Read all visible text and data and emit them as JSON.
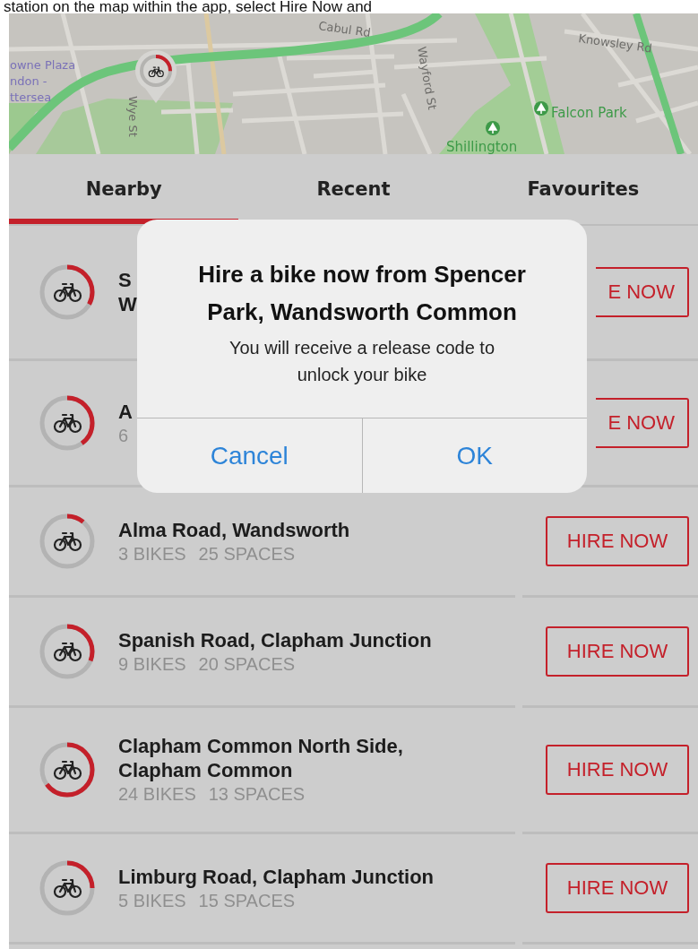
{
  "caption": "station on the map within the app, select Hire Now and",
  "map": {
    "pin": {
      "level": 0.25
    },
    "labels": [
      {
        "text": "Cabul Rd",
        "kind": "road"
      },
      {
        "text": "Knowsley Rd",
        "kind": "road"
      },
      {
        "text": "owne Plaza",
        "kind": "place"
      },
      {
        "text": "ndon -",
        "kind": "place"
      },
      {
        "text": "ttersea",
        "kind": "place"
      },
      {
        "text": "Wye St",
        "kind": "road"
      },
      {
        "text": "Wayford St",
        "kind": "road"
      },
      {
        "text": "Falcon Park",
        "kind": "park"
      },
      {
        "text": "Shillington",
        "kind": "park"
      }
    ]
  },
  "tabs": [
    {
      "label": "Nearby",
      "selected": true
    },
    {
      "label": "Recent",
      "selected": false
    },
    {
      "label": "Favourites",
      "selected": false
    }
  ],
  "stations": [
    {
      "name": [
        "S",
        "W"
      ],
      "level": 0.33,
      "button": "E NOW",
      "covered": true
    },
    {
      "name": [
        "A"
      ],
      "bikes": "6",
      "level": 0.4,
      "button": "E NOW",
      "covered": true
    },
    {
      "name": [
        "Alma Road, Wandsworth"
      ],
      "bikes": "3 BIKES",
      "spaces": "25 SPACES",
      "level": 0.11,
      "button": "HIRE NOW",
      "covered": false
    },
    {
      "name": [
        "Spanish Road, Clapham Junction"
      ],
      "bikes": "9 BIKES",
      "spaces": "20 SPACES",
      "level": 0.31,
      "button": "HIRE NOW",
      "covered": false
    },
    {
      "name": [
        "Clapham Common North Side,",
        "Clapham Common"
      ],
      "bikes": "24 BIKES",
      "spaces": "13 SPACES",
      "level": 0.65,
      "button": "HIRE NOW",
      "covered": false
    },
    {
      "name": [
        "Limburg Road, Clapham Junction"
      ],
      "bikes": "5 BIKES",
      "spaces": "15 SPACES",
      "level": 0.25,
      "button": "HIRE NOW",
      "covered": false
    }
  ],
  "dialog": {
    "title": "Hire a bike now from Spencer Park, Wandsworth Common",
    "message": "You will receive a release code to unlock your bike",
    "buttons": [
      "Cancel",
      "OK"
    ]
  }
}
